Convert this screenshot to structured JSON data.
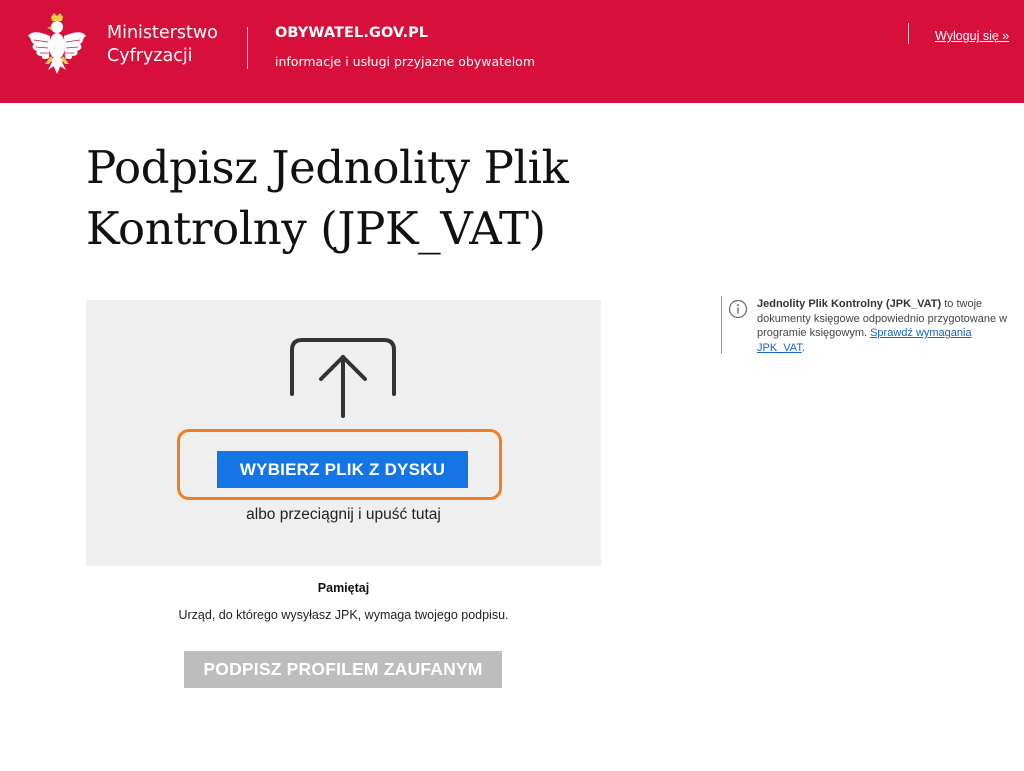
{
  "header": {
    "ministry_line1": "Ministerstwo",
    "ministry_line2": "Cyfryzacji",
    "portal_title": "OBYWATEL.GOV.PL",
    "portal_subtitle": "informacje i usługi przyjazne obywatelom",
    "logout_label": "Wyloguj się »",
    "emblem_icon": "polish-eagle-emblem",
    "background_color": "#d6103b"
  },
  "main": {
    "title": "Podpisz Jednolity Plik Kontrolny (JPK_VAT)",
    "upload_icon": "upload-arrow-icon",
    "choose_file_label": "WYBIERZ PLIK Z DYSKU",
    "drag_drop_text": "albo przeciągnij i upuść tutaj",
    "remember_title": "Pamiętaj",
    "remember_text": "Urząd, do którego wysyłasz JPK, wymaga twojego podpisu.",
    "sign_button_label": "PODPISZ PROFILEM ZAUFANYM",
    "primary_color": "#1575e6",
    "highlight_color": "#f07f21",
    "disabled_color": "#bdbdbd"
  },
  "sidebar_info": {
    "icon": "info-icon",
    "bold_text": "Jednolity Plik Kontrolny (JPK_VAT)",
    "text": " to twoje dokumenty księgowe odpowiednio przygotowane w programie księgowym. ",
    "link_label": "Sprawdź wymagania JPK_VAT",
    "trailing": "."
  }
}
